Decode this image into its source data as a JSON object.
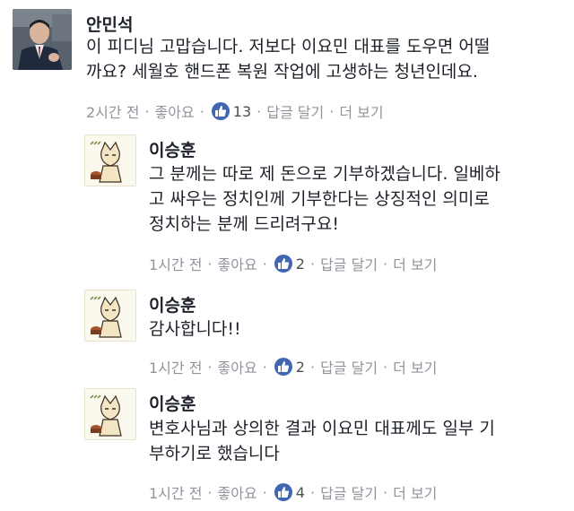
{
  "comments": [
    {
      "author": "안민석",
      "lines": [
        "이 피디님 고맙습니다. 저보다 이요민 대표를 도우면 어떨",
        "까요? 세월호 핸드폰 복원 작업에 고생하는 청년인데요."
      ],
      "time": "2시간 전",
      "like_label": "좋아요",
      "like_count": "13",
      "reply_label": "답글 달기",
      "more_label": "더 보기"
    },
    {
      "author": "이승훈",
      "lines": [
        "그 분께는 따로 제 돈으로 기부하겠습니다. 일베하",
        "고 싸우는 정치인께 기부한다는 상징적인 의미로",
        "정치하는 분께 드리려구요!"
      ],
      "time": "1시간 전",
      "like_label": "좋아요",
      "like_count": "2",
      "reply_label": "답글 달기",
      "more_label": "더 보기"
    },
    {
      "author": "이승훈",
      "lines": [
        "감사합니다!!"
      ],
      "time": "1시간 전",
      "like_label": "좋아요",
      "like_count": "2",
      "reply_label": "답글 달기",
      "more_label": "더 보기"
    },
    {
      "author": "이승훈",
      "lines": [
        "변호사님과 상의한 결과 이요민 대표께도 일부 기",
        "부하기로 했습니다"
      ],
      "time": "1시간 전",
      "like_label": "좋아요",
      "like_count": "4",
      "reply_label": "답글 달기",
      "more_label": "더 보기"
    }
  ],
  "icons": {
    "like": "thumbs-up-icon"
  },
  "colors": {
    "like_badge": "#4267b2",
    "meta_text": "#90949c",
    "text": "#1d2129"
  }
}
